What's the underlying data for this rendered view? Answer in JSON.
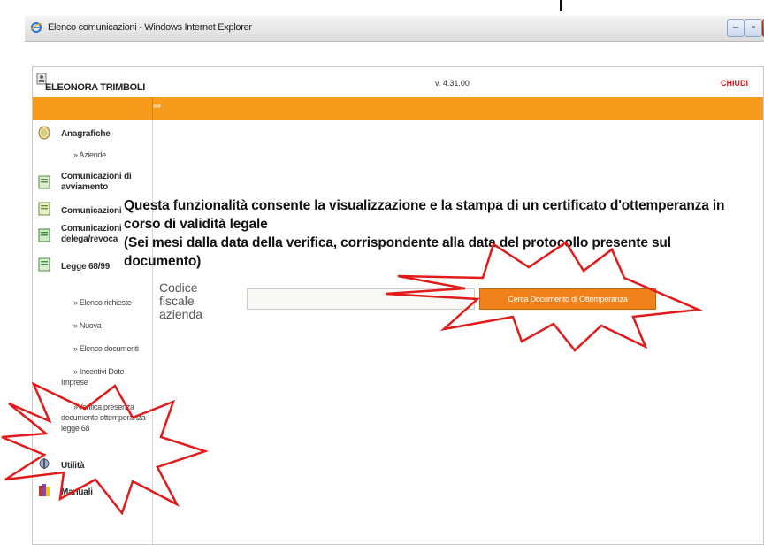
{
  "window": {
    "title": "Elenco comunicazioni - Windows Internet Explorer",
    "buttons": [
      "minimize",
      "restore",
      "close"
    ]
  },
  "header": {
    "user": "ELEONORA TRIMBOLI",
    "version": "v. 4.31.00",
    "close_label": "CHIUDI",
    "breadcrumb_arrows": "»»"
  },
  "sidebar": {
    "sections": [
      {
        "label": "Anagrafiche",
        "icon": "folder-icon"
      },
      {
        "label": "Comunicazioni di avviamento",
        "icon": "document-icon"
      },
      {
        "label": "Comunicazioni",
        "icon": "document-icon"
      },
      {
        "label": "Comunicazioni delega/revoca",
        "icon": "document-icon"
      },
      {
        "label": "Legge 68/99",
        "icon": "document-icon"
      },
      {
        "label": "Utilità",
        "icon": "tools-icon"
      },
      {
        "label": "Manuali",
        "icon": "books-icon"
      }
    ],
    "links": {
      "aziende": "» Aziende",
      "elenco_richieste": "» Elenco richieste",
      "nuova": "» Nuova",
      "elenco_documenti": "» Elenco documenti",
      "incentivi_dote_imprese": "» Incentivi Dote Imprese",
      "verifica_presenza": "»Verifica presenza documento ottemperanza legge 68"
    }
  },
  "main": {
    "headline_line1": "Questa funzionalità consente la visualizzazione e la stampa di un certificato d'ottemperanza in",
    "headline_line2": "corso di validità legale",
    "headline_line3": "(Sei mesi dalla data della verifica, corrispondente alla data del protocollo presente sul documento)",
    "field_label": "Codice fiscale azienda",
    "field_value": "",
    "search_button": "Cerca Documento di Ottemperanza"
  },
  "colors": {
    "accent_orange": "#f79b1c",
    "button_orange": "#f1821b",
    "burst_red": "#e21a1a",
    "close_red": "#d81b1b"
  }
}
